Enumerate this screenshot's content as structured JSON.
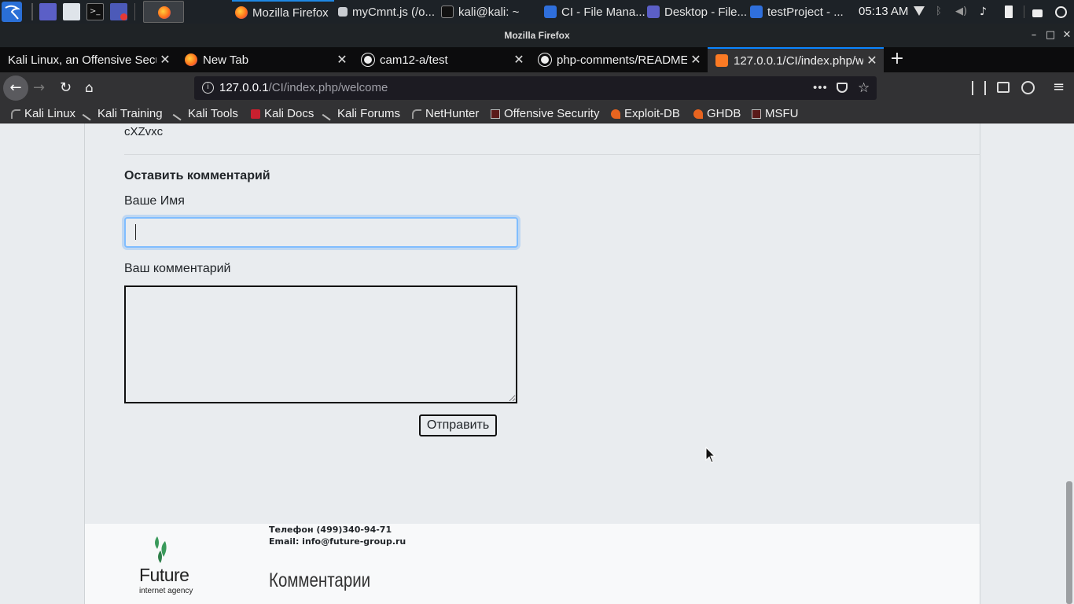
{
  "taskbar": {
    "tasks": [
      {
        "label": "Mozilla Firefox"
      },
      {
        "label": "myCmnt.js (/o..."
      },
      {
        "label": "kali@kali: ~"
      },
      {
        "label": "CI - File Mana..."
      },
      {
        "label": "Desktop - File..."
      },
      {
        "label": "testProject - ..."
      }
    ],
    "clock": "05:13 AM"
  },
  "window": {
    "title": "Mozilla Firefox"
  },
  "tabs": [
    {
      "label": "Kali Linux, an Offensive Secu"
    },
    {
      "label": "New Tab"
    },
    {
      "label": "cam12-a/test"
    },
    {
      "label": "php-comments/README"
    },
    {
      "label": "127.0.0.1/CI/index.php/w"
    }
  ],
  "url": {
    "host": "127.0.0.1",
    "path": "/CI/index.php/welcome"
  },
  "bookmarks": [
    {
      "label": "Kali Linux"
    },
    {
      "label": "Kali Training"
    },
    {
      "label": "Kali Tools"
    },
    {
      "label": "Kali Docs"
    },
    {
      "label": "Kali Forums"
    },
    {
      "label": "NetHunter"
    },
    {
      "label": "Offensive Security"
    },
    {
      "label": "Exploit-DB"
    },
    {
      "label": "GHDB"
    },
    {
      "label": "MSFU"
    }
  ],
  "page": {
    "previous_comment": "cXZvxc",
    "form_title": "Оставить комментарий",
    "name_label": "Ваше Имя",
    "name_value": "",
    "comment_label": "Ваш комментарий",
    "comment_value": "",
    "submit_label": "Отправить"
  },
  "footer": {
    "phone": "Телефон (499)340-94-71",
    "email": "Email: info@future-group.ru",
    "logo_name": "Future",
    "logo_tagline": "internet agency",
    "heading": "Комментарии"
  },
  "colors": {
    "accent": "#0a84ff",
    "logo_green": "#3a9a5b",
    "focus": "#80bdff"
  }
}
